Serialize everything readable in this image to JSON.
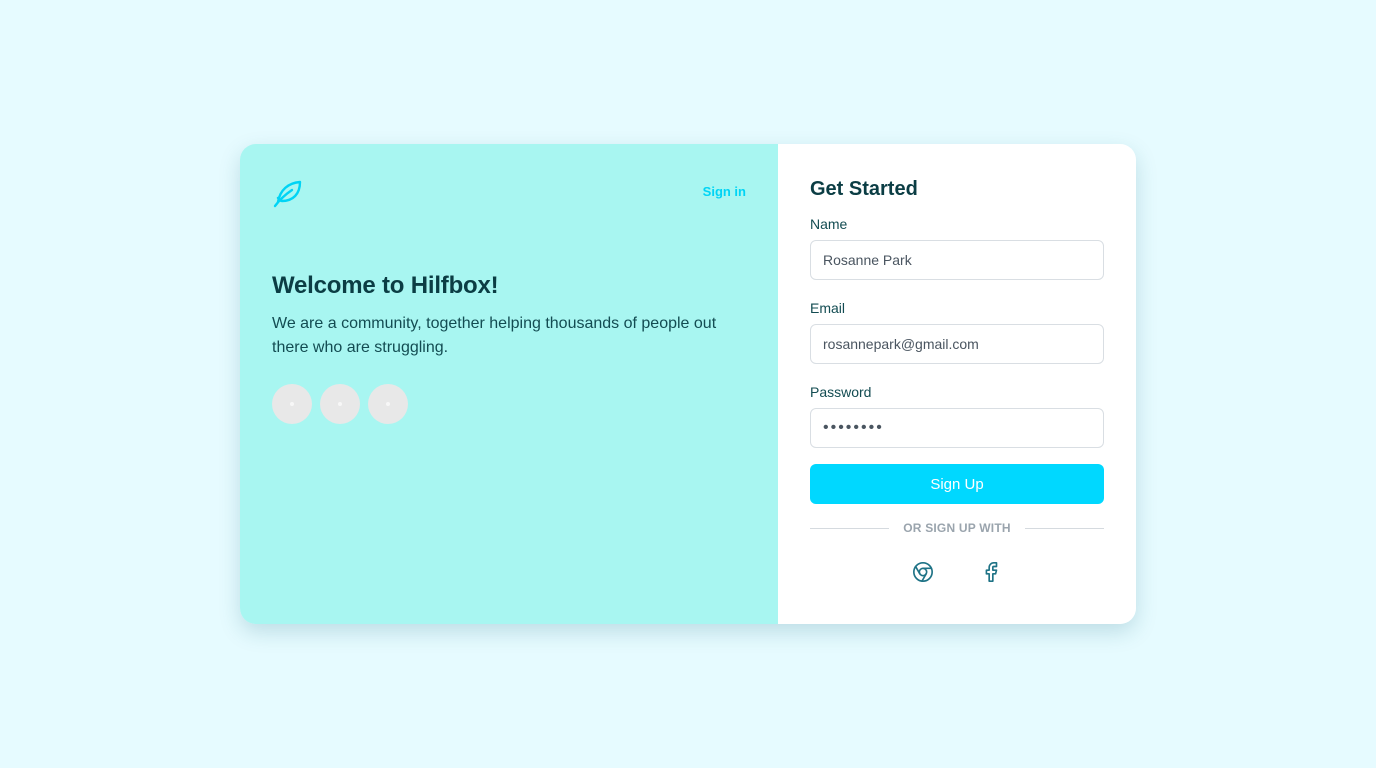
{
  "header": {
    "signin_label": "Sign in"
  },
  "welcome": {
    "title": "Welcome to Hilfbox!",
    "text": "We are a community, together helping thousands of people out there who are struggling."
  },
  "form": {
    "title": "Get Started",
    "name": {
      "label": "Name",
      "value": "Rosanne Park"
    },
    "email": {
      "label": "Email",
      "value": "rosannepark@gmail.com"
    },
    "password": {
      "label": "Password",
      "value": "••••••••"
    },
    "submit_label": "Sign Up",
    "divider_text": "OR SIGN UP WITH"
  },
  "social": [
    {
      "icon": "chrome-icon"
    },
    {
      "icon": "facebook-icon"
    }
  ],
  "colors": {
    "background": "#e6fbff",
    "panel": "#a8f6f1",
    "accent": "#00d8ff",
    "heading": "#0b3d44",
    "icon": "#1f7386"
  }
}
